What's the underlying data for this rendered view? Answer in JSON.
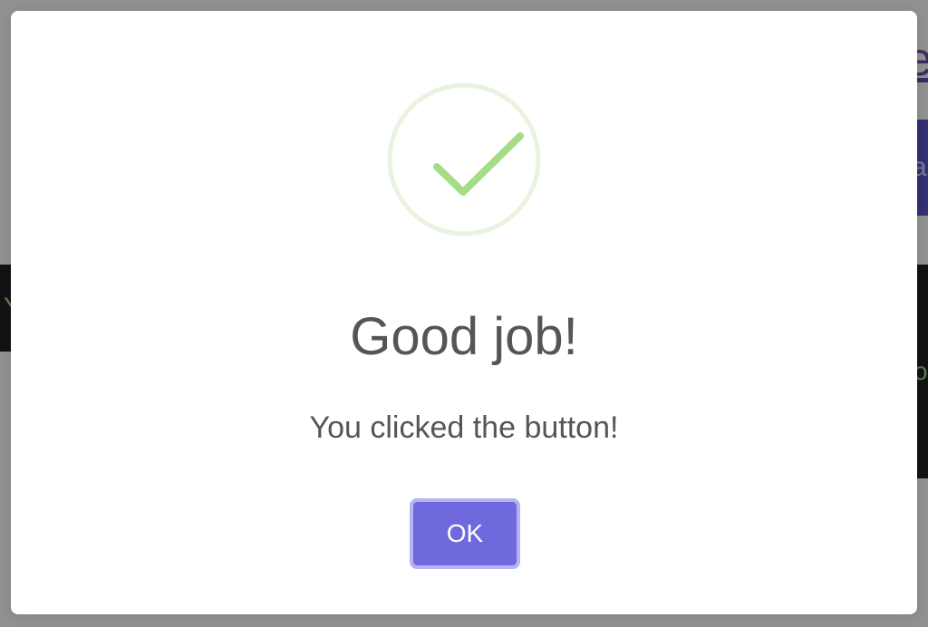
{
  "background": {
    "link_fragment": "e",
    "button_fragment": "a",
    "left_band_fragment": "Y",
    "right_text_fragment": "o"
  },
  "modal": {
    "icon": "success-checkmark-icon",
    "title": "Good job!",
    "message": "You clicked the button!",
    "confirm_label": "OK"
  },
  "colors": {
    "overlay": "#000000",
    "modal_background": "#ffffff",
    "checkmark": "#a5dc86",
    "checkmark_ring": "#e8f4df",
    "text": "#555555",
    "button": "#7069de",
    "button_focus_ring": "#b6b3f1"
  }
}
